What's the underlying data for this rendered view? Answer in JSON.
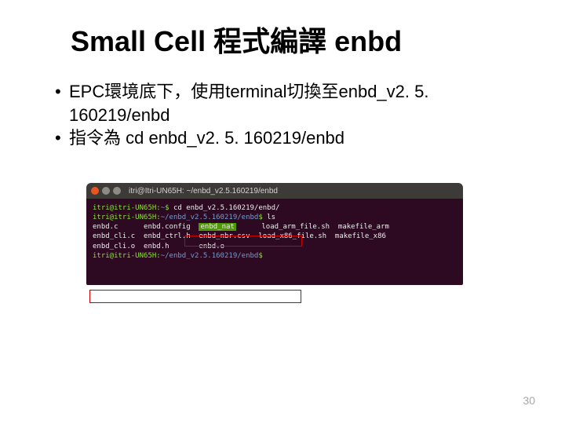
{
  "title": "Small Cell 程式編譯 enbd",
  "bullets": [
    "EPC環境底下，使用terminal切換至enbd_v2. 5. 160219/enbd",
    "指令為 cd enbd_v2. 5. 160219/enbd"
  ],
  "terminal": {
    "window_title": "itri@Itri-UN65H: ~/enbd_v2.5.160219/enbd",
    "prompt_user_host": "itri@itri-UN65H",
    "lines": {
      "l1_path": "~",
      "l1_cmd": "cd enbd_v2.5.160219/enbd/",
      "l2_path": "~/enbd_v2.5.160219/enbd",
      "l2_cmd": "ls",
      "l3_path": "~/enbd_v2.5.160219/enbd"
    },
    "ls_output": {
      "r1c1": "enbd.c",
      "r1c2": "enbd.config",
      "r1c3": "enbd_nat",
      "r1c4": "load_arm_file.sh",
      "r1c5": "makefile_arm",
      "r2c1": "enbd_cli.c",
      "r2c2": "enbd_ctrl.h",
      "r2c3": "enbd_nbr.csv",
      "r2c4": "load_x86_file.sh",
      "r2c5": "makefile_x86",
      "r3c1": "enbd_cli.o",
      "r3c2": "enbd.h",
      "r3c3": "enbd.o"
    }
  },
  "page_number": "30"
}
